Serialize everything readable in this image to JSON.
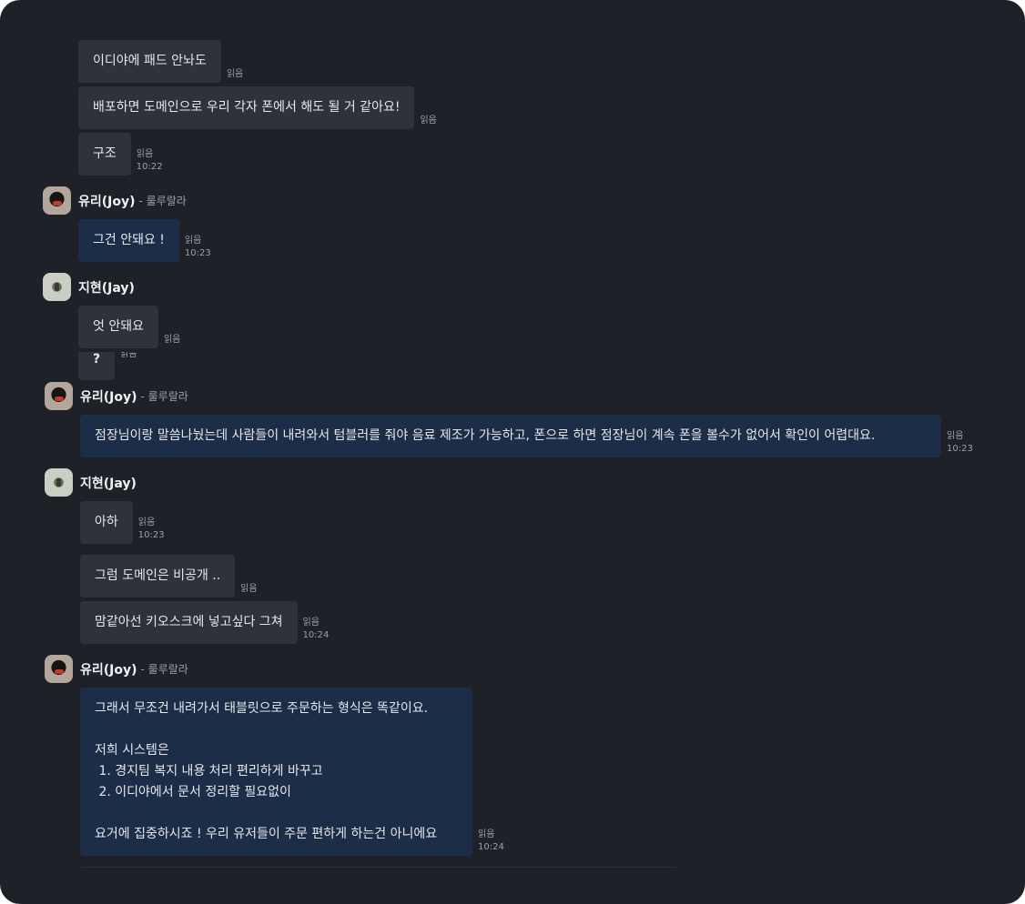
{
  "colors": {
    "background": "#1e2127",
    "bubble_other": "#2d323b",
    "bubble_mine": "#1c2d48",
    "meta_text": "#9aa1ab"
  },
  "read_label": "읽음",
  "senders": {
    "joy": {
      "name": "유리(Joy)",
      "status": "- 룰루랄라",
      "avatar_icon": "profile-photo"
    },
    "jay": {
      "name": "지현(Jay)",
      "avatar_icon": "profile-photo"
    }
  },
  "messages": [
    {
      "text": "이디야에 패드 안놔도",
      "read": "읽음"
    },
    {
      "text": "배포하면 도메인으로 우리 각자 폰에서 해도 될 거 같아요!",
      "read": "읽음"
    },
    {
      "text": "구조",
      "read": "읽음",
      "time": "10:22"
    },
    {
      "text": "그건 안돼요 !",
      "read": "읽음",
      "time": "10:23"
    },
    {
      "text": "엇 안돼요",
      "read": "읽음"
    },
    {
      "text": "?",
      "read": "읽음"
    },
    {
      "text": "점장님이랑 말씀나눴는데 사람들이 내려와서 텀블러를 줘야 음료 제조가 가능하고, 폰으로 하면 점장님이 계속 폰을 볼수가 없어서 확인이 어렵대요.",
      "read": "읽음",
      "time": "10:23"
    },
    {
      "text": "아하",
      "read": "읽음",
      "time": "10:23"
    },
    {
      "text": "그럼 도메인은 비공개 ..",
      "read": "읽음"
    },
    {
      "text": "맘같아선 키오스크에 넣고싶다 그쳐",
      "read": "읽음",
      "time": "10:24"
    },
    {
      "text": "그래서 무조건 내려가서 태블릿으로 주문하는 형식은 똑같이요.\n\n저희 시스템은\n 1. 경지팀 복지 내용 처리 편리하게 바꾸고\n 2. 이디야에서 문서 정리할 필요없이\n\n요거에 집중하시죠 ! 우리 유저들이 주문 편하게 하는건 아니에요",
      "read": "읽음",
      "time": "10:24"
    }
  ]
}
